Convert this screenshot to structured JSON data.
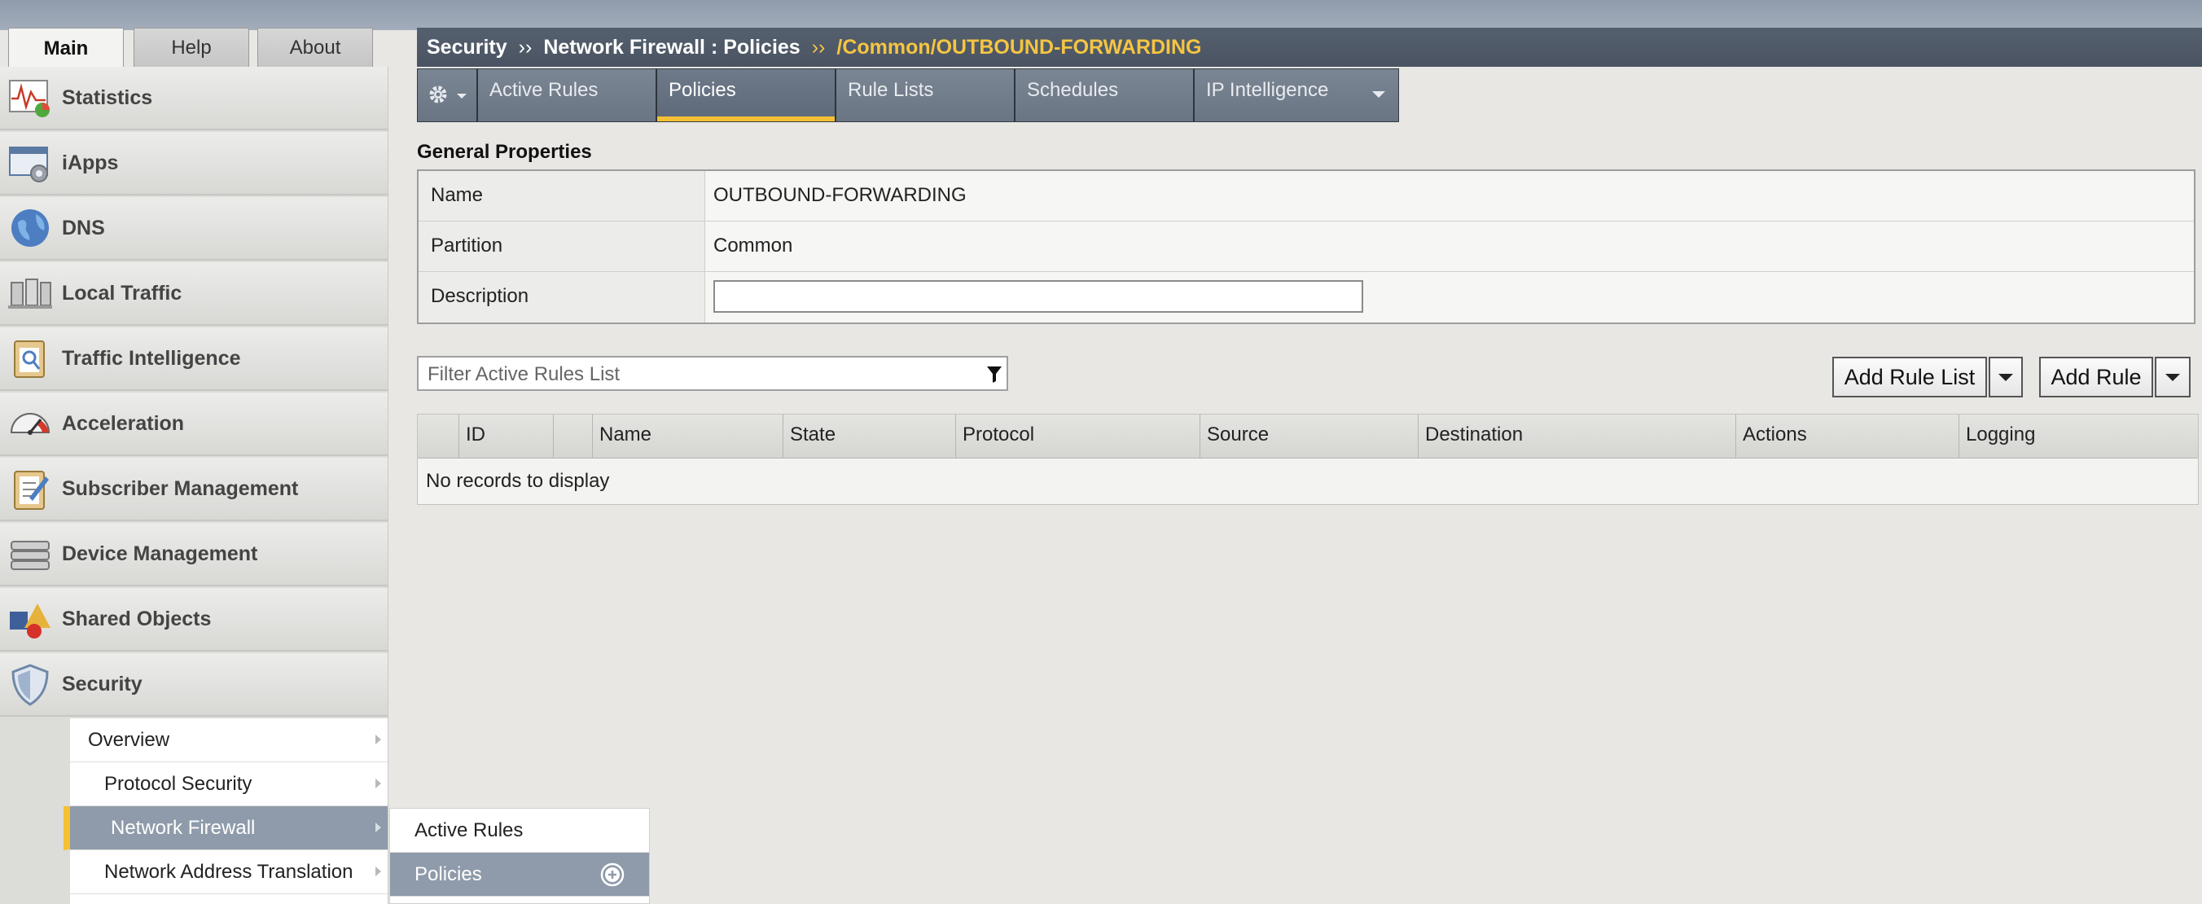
{
  "main_tabs": [
    {
      "label": "Main",
      "active": true
    },
    {
      "label": "Help",
      "active": false
    },
    {
      "label": "About",
      "active": false
    }
  ],
  "sidebar": {
    "items": [
      {
        "label": "Statistics",
        "icon": "statistics-icon"
      },
      {
        "label": "iApps",
        "icon": "iapps-icon"
      },
      {
        "label": "DNS",
        "icon": "dns-globe-icon"
      },
      {
        "label": "Local Traffic",
        "icon": "local-traffic-icon"
      },
      {
        "label": "Traffic Intelligence",
        "icon": "traffic-intelligence-icon"
      },
      {
        "label": "Acceleration",
        "icon": "speedometer-icon"
      },
      {
        "label": "Subscriber Management",
        "icon": "clipboard-icon"
      },
      {
        "label": "Device Management",
        "icon": "device-icon"
      },
      {
        "label": "Shared Objects",
        "icon": "shared-objects-icon"
      },
      {
        "label": "Security",
        "icon": "shield-icon"
      }
    ],
    "security_submenu": [
      {
        "label": "Overview",
        "active": false
      },
      {
        "label": "Protocol Security",
        "active": false
      },
      {
        "label": "Network Firewall",
        "active": true
      },
      {
        "label": "Network Address Translation",
        "active": false
      }
    ],
    "firewall_flyout": [
      {
        "label": "Active Rules",
        "active": false
      },
      {
        "label": "Policies",
        "active": true
      }
    ]
  },
  "breadcrumb": {
    "section": "Security",
    "separator": "››",
    "page": "Network Firewall : Policies",
    "current": "/Common/OUTBOUND-FORWARDING"
  },
  "subtabs": [
    {
      "label": "Active Rules",
      "active": false
    },
    {
      "label": "Policies",
      "active": true
    },
    {
      "label": "Rule Lists",
      "active": false
    },
    {
      "label": "Schedules",
      "active": false
    },
    {
      "label": "IP Intelligence",
      "active": false
    }
  ],
  "general_properties": {
    "title": "General Properties",
    "name_label": "Name",
    "name_value": "OUTBOUND-FORWARDING",
    "partition_label": "Partition",
    "partition_value": "Common",
    "description_label": "Description",
    "description_value": ""
  },
  "rules": {
    "filter_placeholder": "Filter Active Rules List",
    "add_rule_list_label": "Add Rule List",
    "add_rule_label": "Add Rule",
    "columns": [
      "ID",
      "Name",
      "State",
      "Protocol",
      "Source",
      "Destination",
      "Actions",
      "Logging"
    ],
    "empty_message": "No records to display"
  },
  "colors": {
    "accent_yellow": "#f5c033",
    "breadcrumb_bg": "#4a5361",
    "active_menu_bg": "#8f9baa"
  }
}
